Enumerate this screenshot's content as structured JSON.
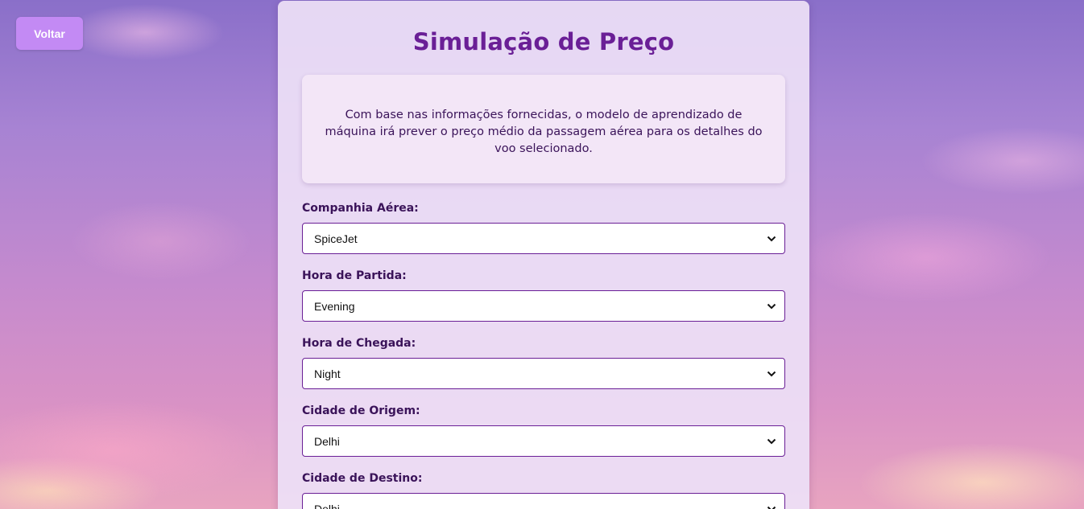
{
  "back_button": {
    "label": "Voltar"
  },
  "page": {
    "title": "Simulação de Preço",
    "description": "Com base nas informações fornecidas, o modelo de aprendizado de máquina irá prever o preço médio da passagem aérea para os detalhes do voo selecionado."
  },
  "form": {
    "fields": [
      {
        "label": "Companhia Aérea:",
        "value": "SpiceJet"
      },
      {
        "label": "Hora de Partida:",
        "value": "Evening"
      },
      {
        "label": "Hora de Chegada:",
        "value": "Night"
      },
      {
        "label": "Cidade de Origem:",
        "value": "Delhi"
      },
      {
        "label": "Cidade de Destino:",
        "value": "Delhi"
      }
    ]
  },
  "icons": {
    "select_arrow": "chevron-down-icon"
  },
  "colors": {
    "accent": "#6a1f96",
    "button": "#c38af4",
    "text": "#3a1359"
  }
}
